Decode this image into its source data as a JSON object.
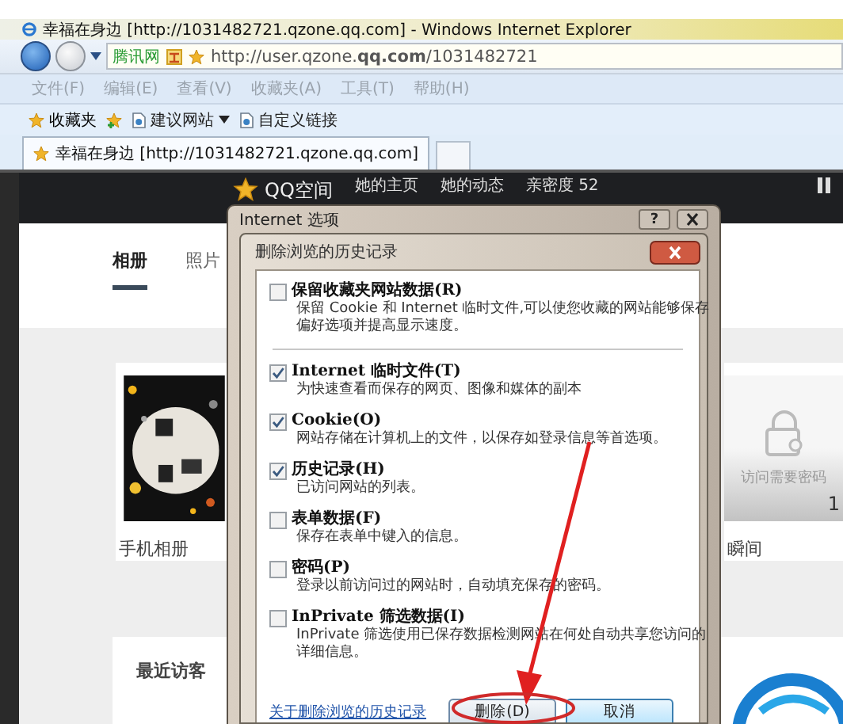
{
  "browser": {
    "title": "幸福在身边 [http://1031482721.qzone.qq.com] - Windows Internet Explorer",
    "address_badge": "腾讯网",
    "address": "http://user.qzone.**qq.com**/1031482721",
    "menu": [
      "文件(F)",
      "编辑(E)",
      "查看(V)",
      "收藏夹(A)",
      "工具(T)",
      "帮助(H)"
    ],
    "favorites": {
      "label": "收藏夹",
      "links": [
        {
          "label": "建议网站",
          "dropdown": true
        },
        {
          "label": "自定义链接",
          "dropdown": false
        }
      ]
    },
    "tabs": [
      {
        "label": "幸福在身边 [http://1031482721.qzone.qq.com]",
        "selected": true
      }
    ]
  },
  "page": {
    "nav": {
      "logo": "QQ空间",
      "items": [
        "她的主页",
        "她的动态",
        "亲密度 52"
      ]
    },
    "subtabs": [
      {
        "label": "相册",
        "selected": true
      },
      {
        "label": "照片",
        "selected": false
      }
    ],
    "albums": [
      {
        "kind": "picture",
        "name": "手机相册"
      },
      {
        "kind": "locked",
        "name": "瞬间",
        "lock_text": "访问需要密码",
        "count": "1"
      }
    ],
    "visitors_title": "最近访客"
  },
  "dialog": {
    "title": "Internet 选项",
    "help_button": "?",
    "inner_title": "删除浏览的历史记录",
    "options": [
      {
        "title": "保留收藏夹网站数据(R)",
        "description": "保留 Cookie 和 Internet 临时文件,可以使您收藏的网站能够保存偏好选项并提高显示速度。",
        "checked": false
      },
      {
        "title": "Internet 临时文件(T)",
        "description": "为快速查看而保存的网页、图像和媒体的副本",
        "checked": true
      },
      {
        "title": "Cookie(O)",
        "description": "网站存储在计算机上的文件，以保存如登录信息等首选项。",
        "checked": true
      },
      {
        "title": "历史记录(H)",
        "description": "已访问网站的列表。",
        "checked": true
      },
      {
        "title": "表单数据(F)",
        "description": "保存在表单中键入的信息。",
        "checked": false
      },
      {
        "title": "密码(P)",
        "description": "登录以前访问过的网站时，自动填充保存的密码。",
        "checked": false
      },
      {
        "title": "InPrivate 筛选数据(I)",
        "description": "InPrivate 筛选使用已保存数据检测网站在何处自动共享您访问的详细信息。",
        "checked": false
      }
    ],
    "link": "关于删除浏览的历史记录",
    "buttons": [
      "删除(D)",
      "取消"
    ]
  }
}
